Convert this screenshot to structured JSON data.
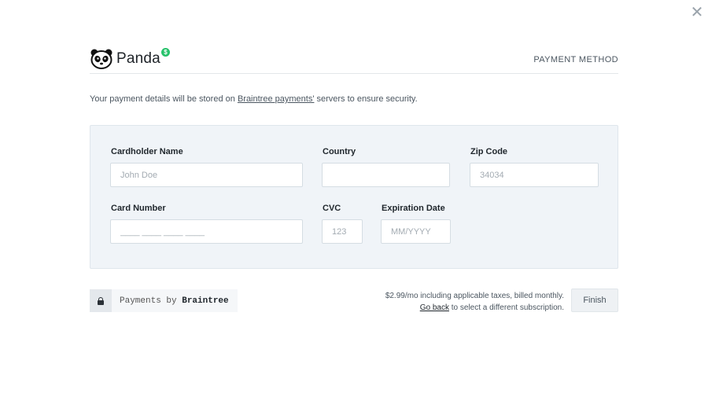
{
  "close": {
    "label": "✕"
  },
  "header": {
    "logo_text": "Panda",
    "logo_badge": "$",
    "title": "PAYMENT METHOD"
  },
  "notice": {
    "before": "Your payment details will be stored on ",
    "link": "Braintree payments'",
    "after": " servers to ensure security."
  },
  "form": {
    "cardholder_name": {
      "label": "Cardholder Name",
      "placeholder": "John Doe",
      "value": ""
    },
    "country": {
      "label": "Country",
      "placeholder": "",
      "value": ""
    },
    "zip_code": {
      "label": "Zip Code",
      "placeholder": "34034",
      "value": ""
    },
    "card_number": {
      "label": "Card Number",
      "placeholder": "____ ____ ____ ____",
      "value": ""
    },
    "cvc": {
      "label": "CVC",
      "placeholder": "123",
      "value": ""
    },
    "expiration_date": {
      "label": "Expiration Date",
      "placeholder": "MM/YYYY",
      "value": ""
    }
  },
  "footer": {
    "badge_prefix": "Payments by ",
    "badge_brand": "Braintree",
    "pricing_line": "$2.99/mo including applicable taxes, billed monthly.",
    "go_back_link": "Go back",
    "go_back_suffix": " to select a different subscription.",
    "finish_label": "Finish"
  }
}
